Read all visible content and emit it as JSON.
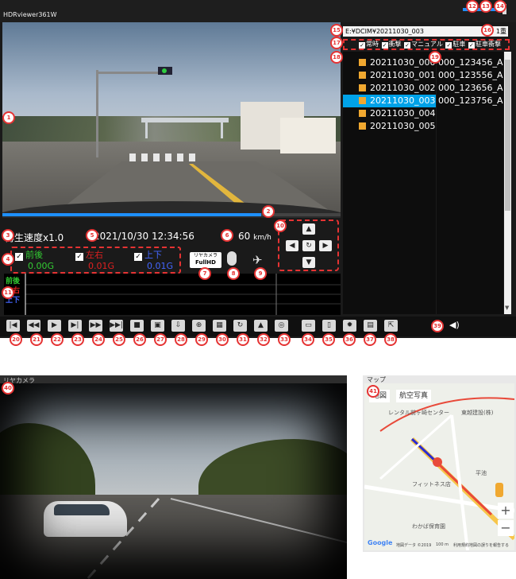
{
  "app": {
    "title": "HDRviewer361W"
  },
  "file_panel": {
    "path": "E:¥DCIM¥20211030_003",
    "path_suffix": "1重",
    "filters": [
      "常時",
      "衝撃",
      "マニュアル",
      "駐車",
      "駐車衝撃"
    ],
    "folders": [
      "20211030_000",
      "20211030_001",
      "20211030_002",
      "20211030_003",
      "20211030_004",
      "20211030_005"
    ],
    "selected_folder": "20211030_003",
    "files": [
      "000_123456_A",
      "000_123556_A",
      "000_123656_A",
      "000_123756_A"
    ]
  },
  "info": {
    "playback_speed": "再生速度x1.0",
    "datetime": "2021/10/30 12:34:56",
    "speed": "60",
    "speed_unit": "km/h",
    "g_sensor": [
      {
        "label": "前後",
        "value": "0.00G",
        "color": "#33cc33"
      },
      {
        "label": "左右",
        "value": "0.01G",
        "color": "#e02020"
      },
      {
        "label": "上下",
        "value": "0.01G",
        "color": "#4466ff"
      }
    ],
    "badge_top": "リヤカメラ",
    "badge_bottom": "FullHD"
  },
  "graph": {
    "labels": [
      "前後",
      "左右",
      "上下"
    ]
  },
  "rear": {
    "title": "リヤカメラ"
  },
  "map": {
    "title": "マップ",
    "tabs": [
      "地図",
      "航空写真"
    ],
    "labels": [
      "レンタル前ヶ崎センター",
      "東越建設(株)",
      "フィットネス店",
      "平池",
      "わかば保育園",
      "Google",
      "地図データ ©2019",
      "100 m",
      "利用規約",
      "地図の誤りを報告する"
    ]
  },
  "markers": [
    "1",
    "2",
    "3",
    "4",
    "5",
    "6",
    "7",
    "8",
    "9",
    "10",
    "11",
    "12",
    "13",
    "14",
    "15",
    "16",
    "17",
    "18",
    "19",
    "20",
    "21",
    "22",
    "23",
    "24",
    "25",
    "26",
    "27",
    "28",
    "29",
    "30",
    "31",
    "32",
    "33",
    "34",
    "35",
    "36",
    "37",
    "38",
    "39",
    "40",
    "41"
  ],
  "toolbar": {
    "icons": [
      "skip-start",
      "prev-frame",
      "play",
      "next-frame",
      "fast-forward",
      "skip-end",
      "snapshot",
      "video-save",
      "download",
      "zoom",
      "image-adjust",
      "rotate-180",
      "lock",
      "globe",
      "folder",
      "delete",
      "settings",
      "print",
      "export"
    ],
    "glyphs": [
      "|◀",
      "◀◀",
      "▶",
      "▶|",
      "▶▶",
      "▶▶|",
      "■",
      "▣",
      "⇩",
      "⊕",
      "▦",
      "↻",
      "▲",
      "◎",
      "▭",
      "▯",
      "✹",
      "▤",
      "⇱"
    ]
  },
  "colors": {
    "accent": "#1e90ff",
    "marker_red": "#e53333",
    "selected_row": "#00a2e8",
    "folder_icon": "#f0a830"
  }
}
